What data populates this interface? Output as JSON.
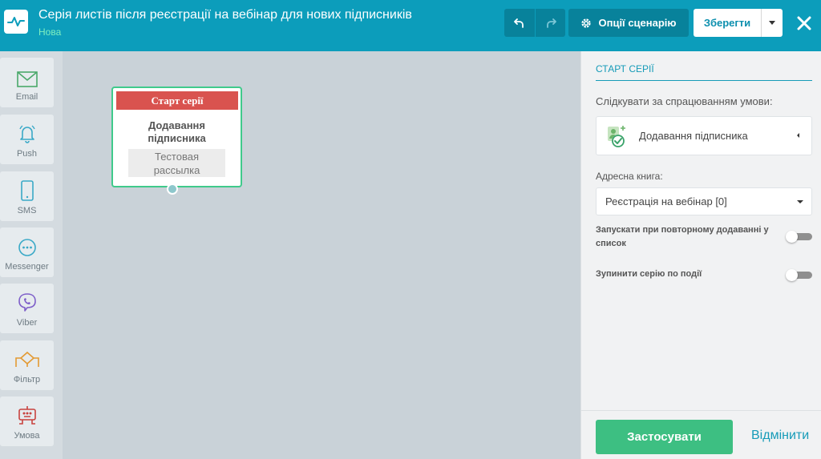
{
  "header": {
    "title": "Серія листів після реєстрації на вебінар для нових підписників",
    "status": "Нова",
    "options_label": "Опції сценарію",
    "save_label": "Зберегти"
  },
  "sidebar": {
    "tools": [
      {
        "label": "Email",
        "icon": "envelope-icon"
      },
      {
        "label": "Push",
        "icon": "bell-icon"
      },
      {
        "label": "SMS",
        "icon": "phone-icon"
      },
      {
        "label": "Messenger",
        "icon": "chat-bubble-icon"
      },
      {
        "label": "Viber",
        "icon": "viber-icon"
      },
      {
        "label": "Фільтр",
        "icon": "filter-icon"
      },
      {
        "label": "Умова",
        "icon": "condition-icon"
      }
    ]
  },
  "node": {
    "header": "Старт серії",
    "title_line1": "Додавання",
    "title_line2": "підписника",
    "sub_line1": "Тестовая",
    "sub_line2": "рассылка"
  },
  "panel": {
    "title": "Старт серії",
    "follow_label": "Слідкувати за спрацюванням умови:",
    "condition_value": "Додавання підписника",
    "addressbook_label": "Адресна книга:",
    "addressbook_value": "Реєстрація на вебінар [0]",
    "toggle1_line1": "Запускати при повторному додаванні у",
    "toggle1_line2": "список",
    "toggle2_label": "Зупинити серію по події",
    "apply_label": "Застосувати",
    "cancel_label": "Відмінити"
  },
  "colors": {
    "header": "#0c9dbb",
    "accent": "#169bb8",
    "apply": "#3dbf82",
    "node_header": "#d9534f"
  }
}
